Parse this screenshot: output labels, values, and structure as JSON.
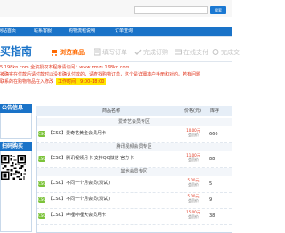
{
  "header": {
    "search": {
      "placeholder": "",
      "button_label": "搜索"
    },
    "nav": [
      "网站首页",
      "联系客服",
      "购物流程说明",
      "订单查询"
    ]
  },
  "guide": {
    "title": "买指南",
    "steps": [
      "浏览商品",
      "填写订单",
      "完成订购",
      "在线支付",
      "完成交"
    ]
  },
  "notice": {
    "line1": "5.198kn.com  全资授权本程序请访问：www.nmzs.198kn.com",
    "line2": "被确实在付款后请付款时以没有确认付款的，请查找购物订单，这个是详细本户手册和对的。若有问题",
    "line3": "联系的在购物物品在入修改",
    "tag": "工作时间：9:00-18:00"
  },
  "sidebar": {
    "panel1_title": "公告信息",
    "panel2_title": "扫码购买"
  },
  "table": {
    "headers": {
      "name": "商品名称",
      "price": "价格(元)",
      "stock": "库存"
    },
    "groups": [
      {
        "title": "爱奇艺会员专区",
        "items": [
          {
            "badge": "CSC",
            "name": "【CSC】爱奇艺黄金会员月卡",
            "price_top": "10.00元",
            "price_label": "会员价",
            "stock": "666"
          }
        ]
      },
      {
        "title": "腾讯视频会员专区",
        "items": [
          {
            "badge": "CSC",
            "name": "【CSC】腾讯视频月卡 支持QQ微信 官方卡",
            "price_top": "11.00元",
            "price_label": "会员价",
            "stock": "88"
          }
        ]
      },
      {
        "title": "其他会员专区",
        "items": [
          {
            "badge": "CSC",
            "name": "【CSC】不同一个月会员(测试)",
            "price_top": "5.00元",
            "price_label": "会员价",
            "stock": "5"
          },
          {
            "badge": "CSC",
            "name": "【CSC】不同一个月会员(测试)",
            "price_top": "5.00元",
            "price_label": "会员价",
            "stock": "9"
          },
          {
            "badge": "CSC",
            "name": "【CSC】哔哩哔哩大会员月卡",
            "price_top": "15.00元",
            "price_label": "会员价",
            "stock": "38"
          }
        ]
      }
    ]
  },
  "colors": {
    "brand_blue": "#1a73c8",
    "accent_orange": "#ff6a00",
    "alert_red": "#e0321a",
    "badge_green": "#7cc33a"
  }
}
